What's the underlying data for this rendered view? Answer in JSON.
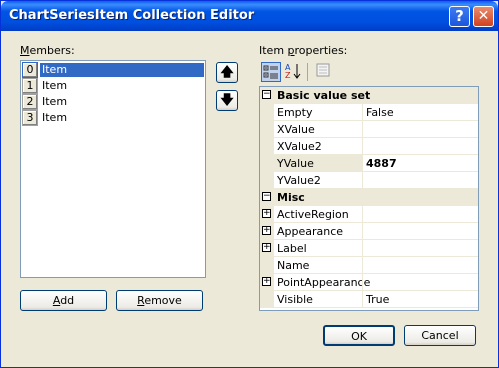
{
  "window": {
    "title": "ChartSeriesItem Collection Editor",
    "help_glyph": "?",
    "close_glyph": "✕"
  },
  "members": {
    "label_u": "M",
    "label_rest": "embers:",
    "items": [
      {
        "index": "0",
        "label": "Item"
      },
      {
        "index": "1",
        "label": "Item"
      },
      {
        "index": "2",
        "label": "Item"
      },
      {
        "index": "3",
        "label": "Item"
      }
    ],
    "selected_index": 0,
    "up_glyph": "🡅",
    "down_glyph": "🡇",
    "add_u": "A",
    "add_rest": "dd",
    "remove_u": "R",
    "remove_rest": "emove"
  },
  "properties": {
    "label_pre": "Item ",
    "label_u": "p",
    "label_rest": "roperties:",
    "toolbar": {
      "categorized_icon": "categorized-icon",
      "alphabetical_icon": "alphabetical-icon",
      "pages_icon": "property-pages-icon"
    },
    "sections": [
      {
        "title": "Basic value set",
        "toggle": "−",
        "rows": [
          {
            "name": "Empty",
            "value": "False",
            "expand": ""
          },
          {
            "name": "XValue",
            "value": "",
            "expand": ""
          },
          {
            "name": "XValue2",
            "value": "",
            "expand": ""
          },
          {
            "name": "YValue",
            "value": "4887",
            "expand": ""
          },
          {
            "name": "YValue2",
            "value": "",
            "expand": ""
          }
        ]
      },
      {
        "title": "Misc",
        "toggle": "−",
        "rows": [
          {
            "name": "ActiveRegion",
            "value": "",
            "expand": "+"
          },
          {
            "name": "Appearance",
            "value": "",
            "expand": "+"
          },
          {
            "name": "Label",
            "value": "",
            "expand": "+"
          },
          {
            "name": "Name",
            "value": "",
            "expand": ""
          },
          {
            "name": "PointAppearance",
            "value": "",
            "expand": "+"
          },
          {
            "name": "Visible",
            "value": "True",
            "expand": ""
          }
        ]
      }
    ]
  },
  "footer": {
    "ok_label": "OK",
    "cancel_label": "Cancel"
  }
}
